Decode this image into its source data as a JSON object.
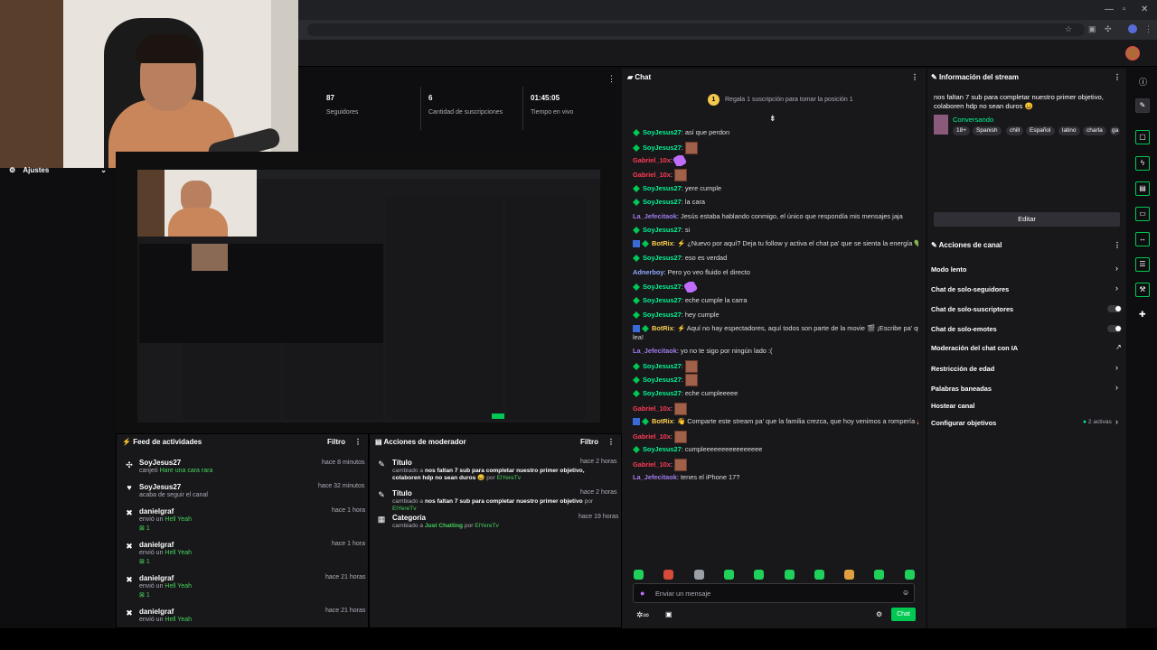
{
  "stats": [
    {
      "value": "87",
      "label": "Seguidores"
    },
    {
      "value": "6",
      "label": "Cantidad de suscripciones"
    },
    {
      "value": "01:45:05",
      "label": "Tiempo en vivo"
    }
  ],
  "settings": {
    "label": "Ajustes"
  },
  "activity": {
    "title": "Feed de actividades",
    "filter": "Filtro",
    "items": [
      {
        "user": "SoyJesus27",
        "action": "canjeó",
        "detail": "Hare una cara rara",
        "time": "hace 8 minutos",
        "icon": "reward-icon"
      },
      {
        "user": "SoyJesus27",
        "action": "acaba de seguir el canal",
        "detail": "",
        "time": "hace 32 minutos",
        "icon": "heart-icon"
      },
      {
        "user": "danielgraf",
        "action": "envió un",
        "detail": "Hell Yeah",
        "count": "1",
        "time": "hace 1 hora",
        "icon": "gift-icon"
      },
      {
        "user": "danielgraf",
        "action": "envió un",
        "detail": "Hell Yeah",
        "count": "1",
        "time": "hace 1 hora",
        "icon": "gift-icon"
      },
      {
        "user": "danielgraf",
        "action": "envió un",
        "detail": "Hell Yeah",
        "count": "1",
        "time": "hace 21 horas",
        "icon": "gift-icon"
      },
      {
        "user": "danielgraf",
        "action": "envió un",
        "detail": "Hell Yeah",
        "count": "",
        "time": "hace 21 horas",
        "icon": "gift-icon"
      }
    ]
  },
  "modactions": {
    "title": "Acciones de moderador",
    "filter": "Filtro",
    "items": [
      {
        "kind": "Título",
        "change": "cambiado a",
        "value": "nos faltan 7 sub para completar nuestro primer objetivo, colaboren hdp no sean duros 😀",
        "by": "por",
        "mod": "ElYereTv",
        "time": "hace 2 horas"
      },
      {
        "kind": "Título",
        "change": "cambiado a",
        "value": "nos faltan 7 sub para completar nuestro primer objetivo",
        "by": "por",
        "mod": "ElYereTv",
        "time": "hace 2 horas"
      },
      {
        "kind": "Categoría",
        "change": "cambiado a",
        "value": "Just Chatting",
        "by": "por",
        "mod": "ElYereTv",
        "time": "hace 19 horas"
      }
    ]
  },
  "chat": {
    "title": "Chat",
    "pinned": "Regala 1 suscripción para tomar la posición 1",
    "pinned_rank": "1",
    "messages": [
      {
        "user": "SoyJesus27",
        "text": "así que perdon",
        "color": "g",
        "badge": true
      },
      {
        "user": "SoyJesus27",
        "text": "",
        "color": "g",
        "badge": true,
        "emote": "face"
      },
      {
        "user": "Gabriel_10x",
        "text": "",
        "color": "r",
        "emote": "purple"
      },
      {
        "user": "Gabriel_10x",
        "text": "",
        "color": "r",
        "emote": "face"
      },
      {
        "user": "SoyJesus27",
        "text": "yere cumple",
        "color": "g",
        "badge": true
      },
      {
        "user": "SoyJesus27",
        "text": "la cara",
        "color": "g",
        "badge": true
      },
      {
        "user": "La_Jefecitaok",
        "text": "Jesús estaba hablando conmigo, el único que respondía mis mensajes jaja",
        "color": "p"
      },
      {
        "user": "SoyJesus27",
        "text": "si",
        "color": "g",
        "badge": true
      },
      {
        "user": "BotRix",
        "text": "⚡ ¿Nuevo por aquí? Deja tu follow y activa el chat pa' que se sienta la energía 💚",
        "color": "y",
        "bot": true
      },
      {
        "user": "SoyJesus27",
        "text": "eso es verdad",
        "color": "g",
        "badge": true
      },
      {
        "user": "Adnerboy",
        "text": "Pero yo veo fluido el directo",
        "color": "b"
      },
      {
        "user": "SoyJesus27",
        "text": "",
        "color": "g",
        "badge": true,
        "emote": "purple"
      },
      {
        "user": "SoyJesus27",
        "text": "eche cumple la carra",
        "color": "g",
        "badge": true
      },
      {
        "user": "SoyJesus27",
        "text": "hey cumple",
        "color": "g",
        "badge": true
      },
      {
        "user": "BotRix",
        "text": "⚡ Aquí no hay espectadores, aquí todos son parte de la movie 🎬 ¡Escribe pa' que te",
        "color": "y",
        "bot": true
      },
      {
        "user": "",
        "text": "lea!",
        "color": "g"
      },
      {
        "user": "La_Jefecitaok",
        "text": "yo no te sigo por ningún lado :(",
        "color": "p"
      },
      {
        "user": "SoyJesus27",
        "text": "",
        "color": "g",
        "badge": true,
        "emote": "face"
      },
      {
        "user": "SoyJesus27",
        "text": "",
        "color": "g",
        "badge": true,
        "emote": "face"
      },
      {
        "user": "SoyJesus27",
        "text": "eche cumpleeeee",
        "color": "g",
        "badge": true
      },
      {
        "user": "Gabriel_10x",
        "text": "",
        "color": "r",
        "emote": "face"
      },
      {
        "user": "BotRix",
        "text": "👋 Comparte este stream pa' que la familia crezca, que hoy venimos a rompería 🚀",
        "color": "y",
        "bot": true
      },
      {
        "user": "Gabriel_10x",
        "text": "",
        "color": "r",
        "emote": "face"
      },
      {
        "user": "SoyJesus27",
        "text": "cumpleeeeeeeeeeeeeeee",
        "color": "g",
        "badge": true
      },
      {
        "user": "Gabriel_10x",
        "text": "",
        "color": "r",
        "emote": "face"
      },
      {
        "user": "La_Jefecitaok",
        "text": "tenes el iPhone 17?",
        "color": "p"
      }
    ],
    "input_placeholder": "Enviar un mensaje",
    "send_label": "Chat"
  },
  "info": {
    "title": "Información del stream",
    "stream_title": "nos faltan 7 sub para completar nuestro primer objetivo, colaboren hdp no sean duros 😀",
    "category": "Conversando",
    "tags": [
      "18+",
      "Spanish",
      "chill",
      "Español",
      "latino",
      "charla",
      "ga"
    ],
    "edit_label": "Editar"
  },
  "channel": {
    "title": "Acciones de canal",
    "items": [
      {
        "label": "Modo lento",
        "control": "chevron"
      },
      {
        "label": "Chat de solo-seguidores",
        "control": "chevron"
      },
      {
        "label": "Chat de solo-suscriptores",
        "control": "toggle"
      },
      {
        "label": "Chat de solo-emotes",
        "control": "toggle"
      },
      {
        "label": "Moderación del chat con IA",
        "control": "external"
      },
      {
        "label": "Restricción de edad",
        "control": "chevron"
      },
      {
        "label": "Palabras baneadas",
        "control": "chevron"
      },
      {
        "label": "Hostear canal",
        "control": "none"
      },
      {
        "label": "Configurar objetivos",
        "control": "chevron",
        "note": "2 activas"
      }
    ]
  },
  "colors": {
    "accent": "#00f593",
    "panel": "#18181b",
    "background": "#0e0e10"
  }
}
